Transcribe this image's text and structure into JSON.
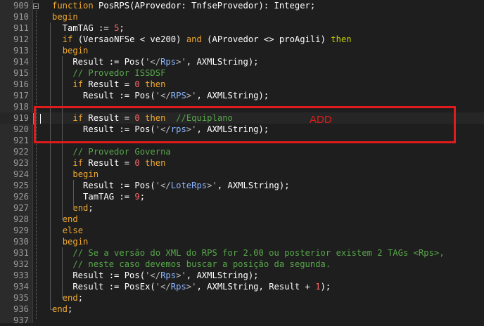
{
  "colors": {
    "background": "#1e1e1e",
    "gutter": "#2b2b2b",
    "keyword": "#f0a830",
    "keyword_alt": "#c6d000",
    "string": "#bdbdbd",
    "string_inner": "#8ab4ff",
    "number": "#ff6666",
    "comment": "#57a64a",
    "annotation": "#e01b1b",
    "change_marker": "#33cc33"
  },
  "annotation": {
    "label": "ADD"
  },
  "editor": {
    "fold_icon": "minus-box-icon",
    "lines": [
      {
        "num": "909",
        "segs": [
          {
            "t": "kw",
            "v": "function"
          },
          {
            "t": "plain",
            "v": " PosRPS(AProvedor: TnfseProvedor): Integer;"
          }
        ]
      },
      {
        "num": "910",
        "segs": [
          {
            "t": "kw",
            "v": "begin"
          }
        ]
      },
      {
        "num": "911",
        "segs": [
          {
            "t": "plain",
            "v": "  TamTAG := "
          },
          {
            "t": "num",
            "v": "5"
          },
          {
            "t": "plain",
            "v": ";"
          }
        ]
      },
      {
        "num": "912",
        "segs": [
          {
            "t": "plain",
            "v": "  "
          },
          {
            "t": "kw",
            "v": "if"
          },
          {
            "t": "plain",
            "v": " (VersaoNFSe < ve200) "
          },
          {
            "t": "kw",
            "v": "and"
          },
          {
            "t": "plain",
            "v": " (AProvedor <> proAgili) "
          },
          {
            "t": "kw2",
            "v": "then"
          }
        ]
      },
      {
        "num": "913",
        "segs": [
          {
            "t": "plain",
            "v": "  "
          },
          {
            "t": "kw",
            "v": "begin"
          }
        ]
      },
      {
        "num": "914",
        "segs": [
          {
            "t": "plain",
            "v": "    Result := Pos("
          },
          {
            "t": "str",
            "v": "'</"
          },
          {
            "t": "strx",
            "v": "Rps"
          },
          {
            "t": "str",
            "v": ">'"
          },
          {
            "t": "plain",
            "v": ", AXMLString);"
          }
        ]
      },
      {
        "num": "915",
        "segs": [
          {
            "t": "plain",
            "v": "    "
          },
          {
            "t": "cmt",
            "v": "// Provedor ISSDSF"
          }
        ]
      },
      {
        "num": "916",
        "segs": [
          {
            "t": "plain",
            "v": "    "
          },
          {
            "t": "kw",
            "v": "if"
          },
          {
            "t": "plain",
            "v": " Result = "
          },
          {
            "t": "num",
            "v": "0"
          },
          {
            "t": "plain",
            "v": " "
          },
          {
            "t": "kw",
            "v": "then"
          }
        ]
      },
      {
        "num": "917",
        "segs": [
          {
            "t": "plain",
            "v": "      Result := Pos("
          },
          {
            "t": "str",
            "v": "'</"
          },
          {
            "t": "strx",
            "v": "RPS"
          },
          {
            "t": "str",
            "v": ">'"
          },
          {
            "t": "plain",
            "v": ", AXMLString);"
          }
        ]
      },
      {
        "num": "918",
        "segs": []
      },
      {
        "num": "919",
        "current": true,
        "segs": [
          {
            "t": "plain",
            "v": "    "
          },
          {
            "t": "kw",
            "v": "if"
          },
          {
            "t": "plain",
            "v": " Result = "
          },
          {
            "t": "num",
            "v": "0"
          },
          {
            "t": "plain",
            "v": " "
          },
          {
            "t": "kw",
            "v": "then"
          },
          {
            "t": "plain",
            "v": "  "
          },
          {
            "t": "cmt",
            "v": "//Equiplano"
          }
        ]
      },
      {
        "num": "920",
        "segs": [
          {
            "t": "plain",
            "v": "      Result := Pos("
          },
          {
            "t": "str",
            "v": "'</"
          },
          {
            "t": "strx",
            "v": "rps"
          },
          {
            "t": "str",
            "v": ">'"
          },
          {
            "t": "plain",
            "v": ", AXMLString);"
          }
        ]
      },
      {
        "num": "921",
        "segs": []
      },
      {
        "num": "922",
        "segs": [
          {
            "t": "plain",
            "v": "    "
          },
          {
            "t": "cmt",
            "v": "// Provedor Governa"
          }
        ]
      },
      {
        "num": "923",
        "segs": [
          {
            "t": "plain",
            "v": "    "
          },
          {
            "t": "kw",
            "v": "if"
          },
          {
            "t": "plain",
            "v": " Result = "
          },
          {
            "t": "num",
            "v": "0"
          },
          {
            "t": "plain",
            "v": " "
          },
          {
            "t": "kw",
            "v": "then"
          }
        ]
      },
      {
        "num": "924",
        "segs": [
          {
            "t": "plain",
            "v": "    "
          },
          {
            "t": "kw",
            "v": "begin"
          }
        ]
      },
      {
        "num": "925",
        "segs": [
          {
            "t": "plain",
            "v": "      Result := Pos("
          },
          {
            "t": "str",
            "v": "'</"
          },
          {
            "t": "strx",
            "v": "LoteRps"
          },
          {
            "t": "str",
            "v": ">'"
          },
          {
            "t": "plain",
            "v": ", AXMLString);"
          }
        ]
      },
      {
        "num": "926",
        "segs": [
          {
            "t": "plain",
            "v": "      TamTAG := "
          },
          {
            "t": "num",
            "v": "9"
          },
          {
            "t": "plain",
            "v": ";"
          }
        ]
      },
      {
        "num": "927",
        "segs": [
          {
            "t": "plain",
            "v": "    "
          },
          {
            "t": "kw",
            "v": "end"
          },
          {
            "t": "plain",
            "v": ";"
          }
        ]
      },
      {
        "num": "928",
        "segs": [
          {
            "t": "plain",
            "v": "  "
          },
          {
            "t": "kw",
            "v": "end"
          }
        ]
      },
      {
        "num": "929",
        "segs": [
          {
            "t": "plain",
            "v": "  "
          },
          {
            "t": "kw",
            "v": "else"
          }
        ]
      },
      {
        "num": "930",
        "segs": [
          {
            "t": "plain",
            "v": "  "
          },
          {
            "t": "kw",
            "v": "begin"
          }
        ]
      },
      {
        "num": "931",
        "segs": [
          {
            "t": "plain",
            "v": "    "
          },
          {
            "t": "cmt",
            "v": "// Se a versão do XML do RPS for 2.00 ou posterior existem 2 TAGs <Rps>,"
          }
        ]
      },
      {
        "num": "932",
        "segs": [
          {
            "t": "plain",
            "v": "    "
          },
          {
            "t": "cmt",
            "v": "// neste caso devemos buscar a posição da segunda."
          }
        ]
      },
      {
        "num": "933",
        "segs": [
          {
            "t": "plain",
            "v": "    Result := Pos("
          },
          {
            "t": "str",
            "v": "'</"
          },
          {
            "t": "strx",
            "v": "Rps"
          },
          {
            "t": "str",
            "v": ">'"
          },
          {
            "t": "plain",
            "v": ", AXMLString);"
          }
        ]
      },
      {
        "num": "934",
        "segs": [
          {
            "t": "plain",
            "v": "    Result := PosEx("
          },
          {
            "t": "str",
            "v": "'</"
          },
          {
            "t": "strx",
            "v": "Rps"
          },
          {
            "t": "str",
            "v": ">'"
          },
          {
            "t": "plain",
            "v": ", AXMLString, Result + "
          },
          {
            "t": "num",
            "v": "1"
          },
          {
            "t": "plain",
            "v": ");"
          }
        ]
      },
      {
        "num": "935",
        "segs": [
          {
            "t": "plain",
            "v": "  "
          },
          {
            "t": "kw",
            "v": "end"
          },
          {
            "t": "plain",
            "v": ";"
          }
        ]
      },
      {
        "num": "936",
        "segs": [
          {
            "t": "kw",
            "v": "end"
          },
          {
            "t": "plain",
            "v": ";"
          }
        ]
      },
      {
        "num": "937",
        "segs": []
      }
    ]
  }
}
